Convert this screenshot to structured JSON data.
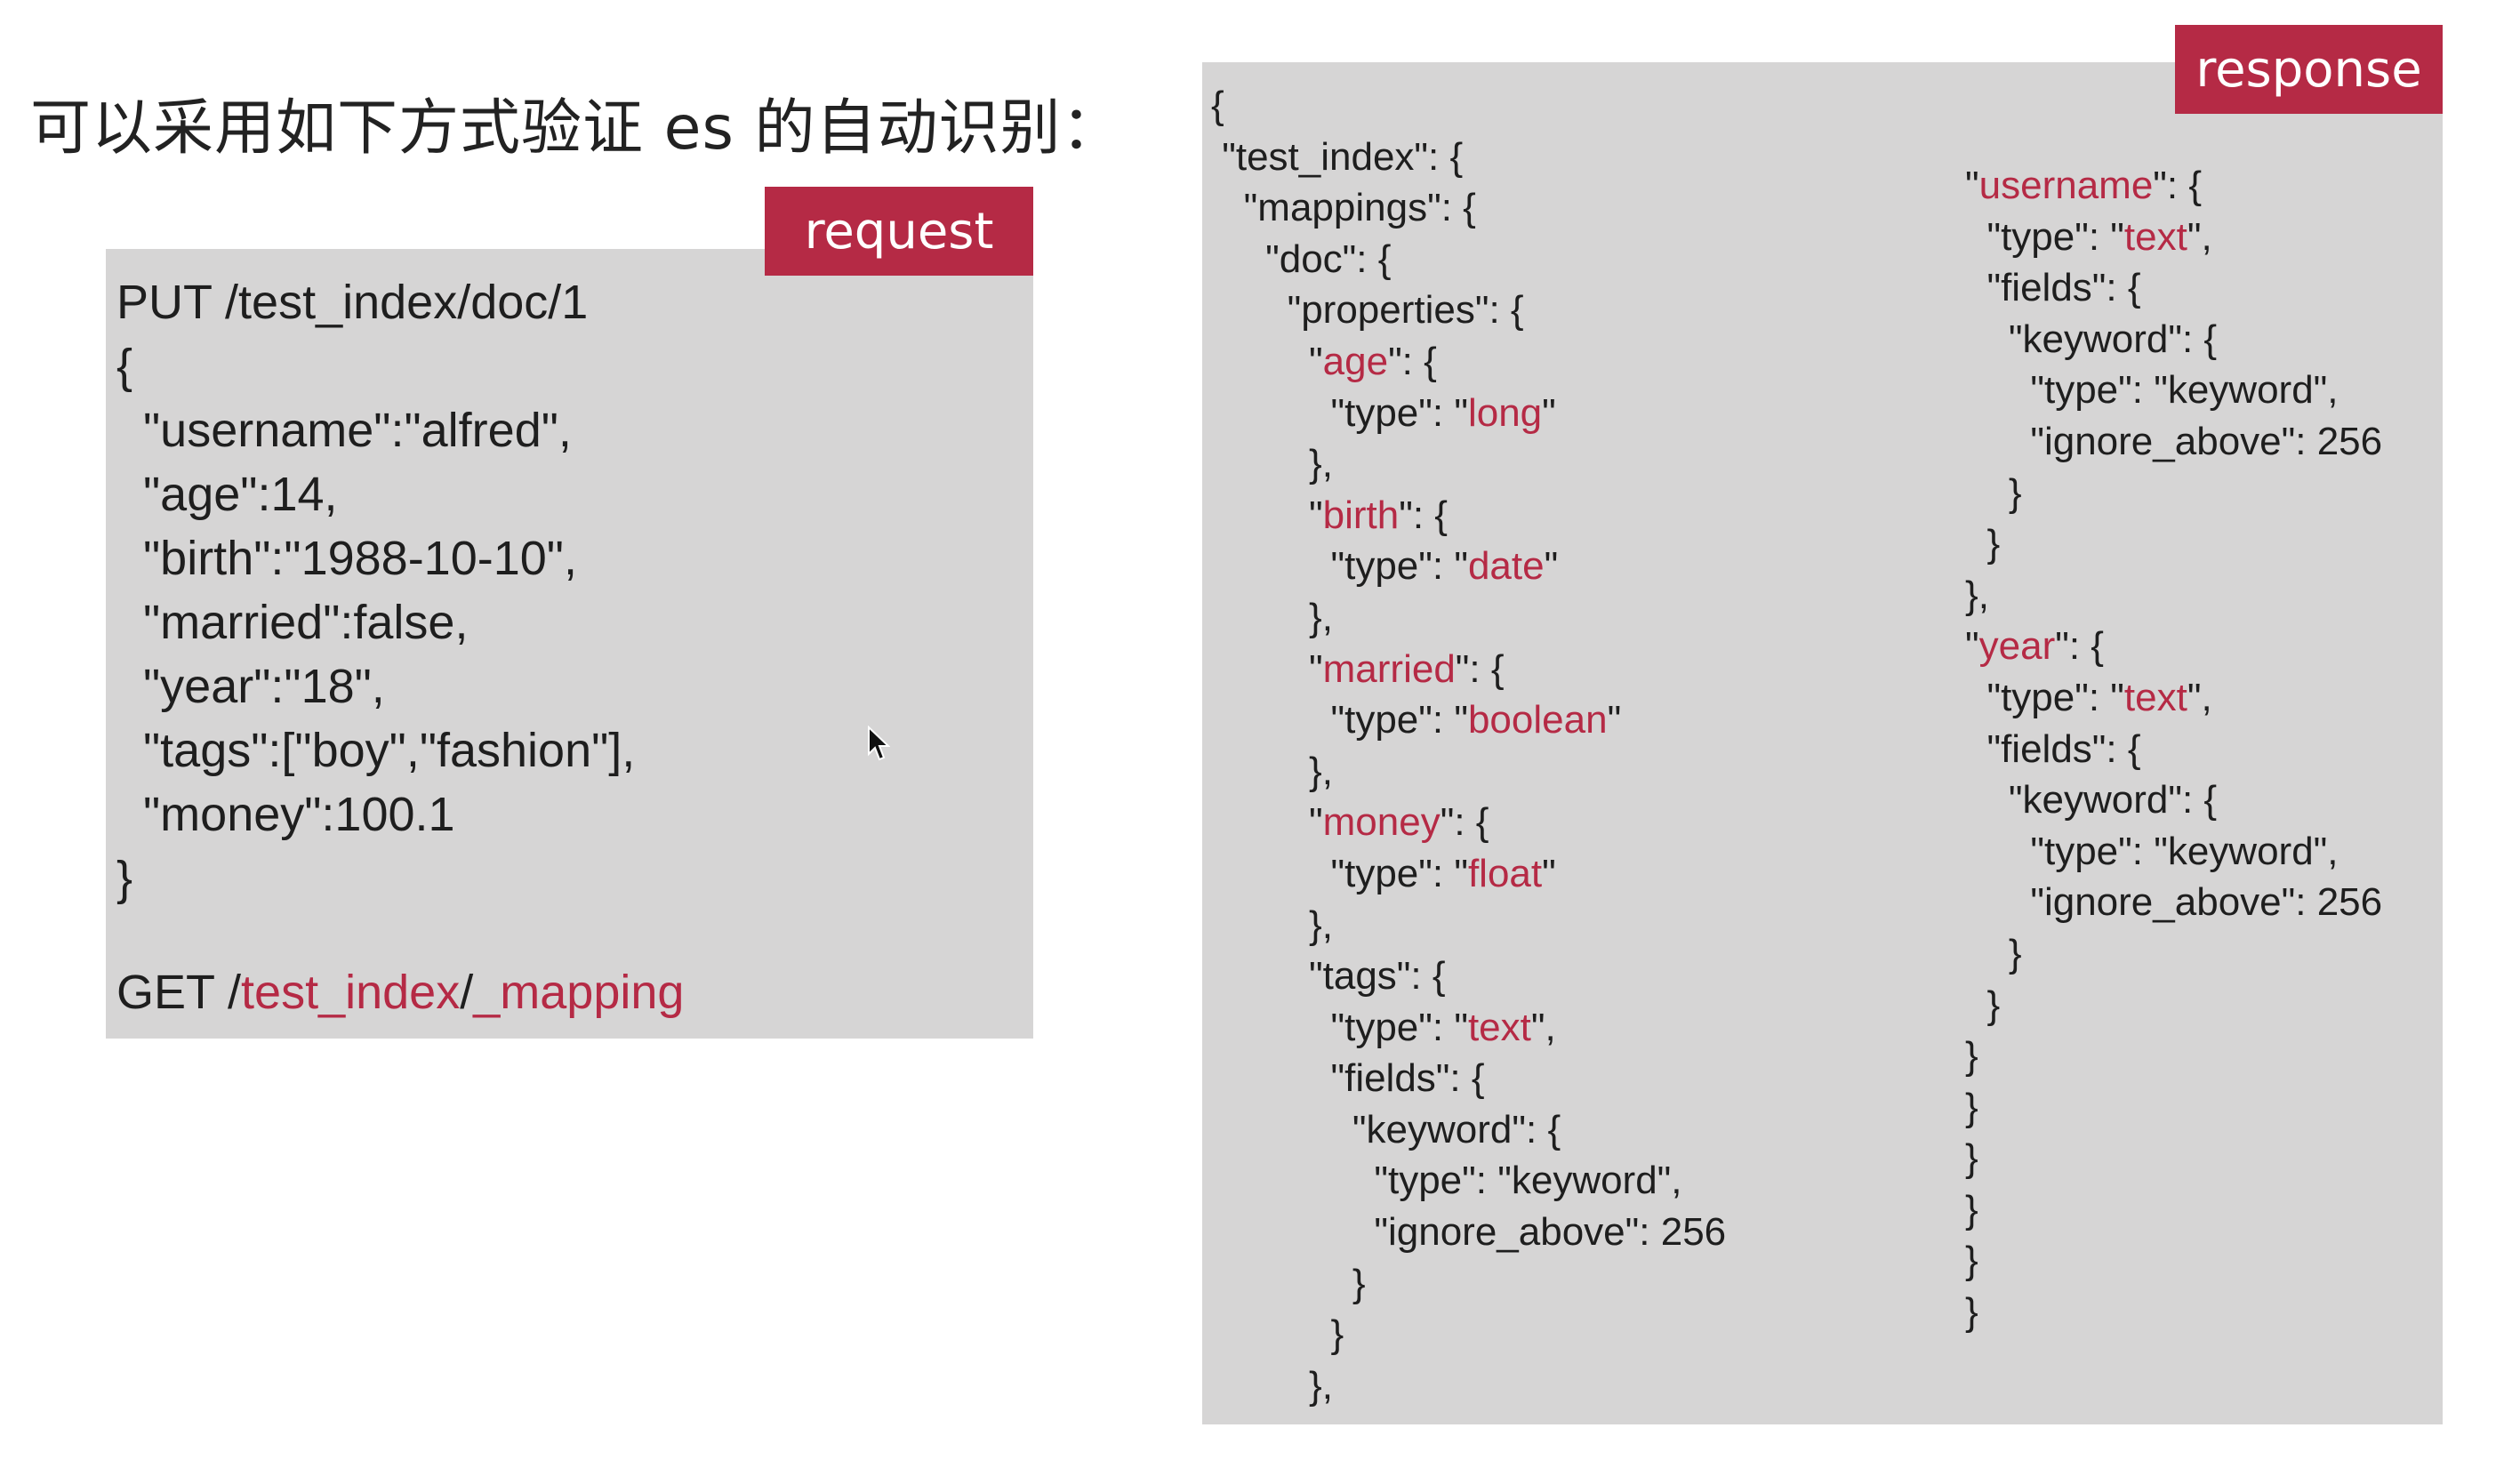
{
  "slide": {
    "title": "可以采用如下方式验证 es 的自动识别："
  },
  "request": {
    "tag_label": "request",
    "lines": [
      "PUT /test_index/doc/1",
      "{",
      "  \"username\":\"alfred\",",
      "  \"age\":14,",
      "  \"birth\":\"1988-10-10\",",
      "  \"married\":false,",
      "  \"year\":\"18\",",
      "  \"tags\":[\"boy\",\"fashion\"],",
      "  \"money\":100.1",
      "}"
    ],
    "get_method": "GET /",
    "get_index": "test_index",
    "get_sep": "/",
    "get_endpoint": "_mapping"
  },
  "response": {
    "tag_label": "response",
    "left_column": [
      [
        [
          "{",
          false
        ]
      ],
      [
        [
          " \"test_index\": {",
          false
        ]
      ],
      [
        [
          "   \"mappings\": {",
          false
        ]
      ],
      [
        [
          "     \"doc\": {",
          false
        ]
      ],
      [
        [
          "       \"properties\": {",
          false
        ]
      ],
      [
        [
          "         \"",
          false
        ],
        [
          "age",
          true
        ],
        [
          "\": {",
          false
        ]
      ],
      [
        [
          "           \"type\": \"",
          false
        ],
        [
          "long",
          true
        ],
        [
          "\"",
          false
        ]
      ],
      [
        [
          "         },",
          false
        ]
      ],
      [
        [
          "         \"",
          false
        ],
        [
          "birth",
          true
        ],
        [
          "\": {",
          false
        ]
      ],
      [
        [
          "           \"type\": \"",
          false
        ],
        [
          "date",
          true
        ],
        [
          "\"",
          false
        ]
      ],
      [
        [
          "         },",
          false
        ]
      ],
      [
        [
          "         \"",
          false
        ],
        [
          "married",
          true
        ],
        [
          "\": {",
          false
        ]
      ],
      [
        [
          "           \"type\": \"",
          false
        ],
        [
          "boolean",
          true
        ],
        [
          "\"",
          false
        ]
      ],
      [
        [
          "         },",
          false
        ]
      ],
      [
        [
          "         \"",
          false
        ],
        [
          "money",
          true
        ],
        [
          "\": {",
          false
        ]
      ],
      [
        [
          "           \"type\": \"",
          false
        ],
        [
          "float",
          true
        ],
        [
          "\"",
          false
        ]
      ],
      [
        [
          "         },",
          false
        ]
      ],
      [
        [
          "         \"tags\": {",
          false
        ]
      ],
      [
        [
          "           \"type\": \"",
          false
        ],
        [
          "text",
          true
        ],
        [
          "\",",
          false
        ]
      ],
      [
        [
          "           \"fields\": {",
          false
        ]
      ],
      [
        [
          "             \"keyword\": {",
          false
        ]
      ],
      [
        [
          "               \"type\": \"keyword\",",
          false
        ]
      ],
      [
        [
          "               \"ignore_above\": 256",
          false
        ]
      ],
      [
        [
          "             }",
          false
        ]
      ],
      [
        [
          "           }",
          false
        ]
      ],
      [
        [
          "         },",
          false
        ]
      ]
    ],
    "right_column": [
      [
        [
          "\"",
          false
        ],
        [
          "username",
          true
        ],
        [
          "\": {",
          false
        ]
      ],
      [
        [
          "  \"type\": \"",
          false
        ],
        [
          "text",
          true
        ],
        [
          "\",",
          false
        ]
      ],
      [
        [
          "  \"fields\": {",
          false
        ]
      ],
      [
        [
          "    \"keyword\": {",
          false
        ]
      ],
      [
        [
          "      \"type\": \"keyword\",",
          false
        ]
      ],
      [
        [
          "      \"ignore_above\": 256",
          false
        ]
      ],
      [
        [
          "    }",
          false
        ]
      ],
      [
        [
          "  }",
          false
        ]
      ],
      [
        [
          "},",
          false
        ]
      ],
      [
        [
          "\"",
          false
        ],
        [
          "year",
          true
        ],
        [
          "\": {",
          false
        ]
      ],
      [
        [
          "  \"type\": \"",
          false
        ],
        [
          "text",
          true
        ],
        [
          "\",",
          false
        ]
      ],
      [
        [
          "  \"fields\": {",
          false
        ]
      ],
      [
        [
          "    \"keyword\": {",
          false
        ]
      ],
      [
        [
          "      \"type\": \"keyword\",",
          false
        ]
      ],
      [
        [
          "      \"ignore_above\": 256",
          false
        ]
      ],
      [
        [
          "    }",
          false
        ]
      ],
      [
        [
          "  }",
          false
        ]
      ],
      [
        [
          "}",
          false
        ]
      ],
      [
        [
          "}",
          false
        ]
      ],
      [
        [
          "}",
          false
        ]
      ],
      [
        [
          "}",
          false
        ]
      ],
      [
        [
          "}",
          false
        ]
      ],
      [
        [
          "}",
          false
        ]
      ]
    ]
  },
  "colors": {
    "accent": "#b52a45",
    "panel": "#d6d5d5",
    "text": "#1e1e1e"
  },
  "icons": {
    "cursor": "mouse-pointer-icon"
  }
}
